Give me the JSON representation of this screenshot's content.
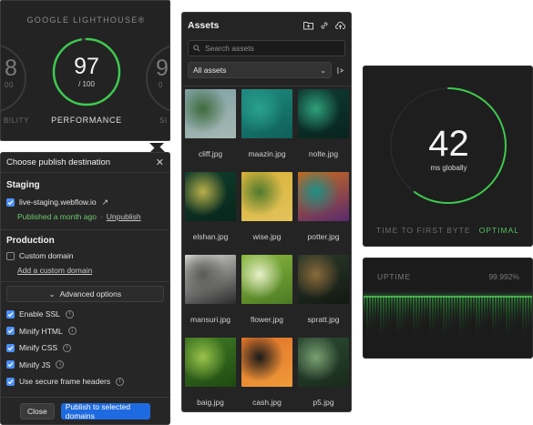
{
  "lighthouse": {
    "title": "GOOGLE LIGHTHOUSE®",
    "main_score": "97",
    "main_sub": "/ 100",
    "main_label": "PERFORMANCE",
    "main_progress": 0.97,
    "left_ghost_score": "8",
    "left_ghost_sub": "00",
    "left_ghost_label": "BILITY",
    "right_ghost_score": "9",
    "right_ghost_sub": "0",
    "right_ghost_label": "SI",
    "accent": "#3ec94e"
  },
  "publish": {
    "title": "Choose publish destination",
    "staging": {
      "heading": "Staging",
      "domain": "live-staging.webflow.io",
      "status": "Published a month ago",
      "separator": "·",
      "unpublish": "Unpublish",
      "checked": true
    },
    "production": {
      "heading": "Production",
      "custom_domain": "Custom domain",
      "add_link": "Add a custom domain",
      "checked": false
    },
    "advanced_label": "Advanced options",
    "options": [
      {
        "label": "Enable SSL",
        "checked": true
      },
      {
        "label": "Minify HTML",
        "checked": true
      },
      {
        "label": "Minify CSS",
        "checked": true
      },
      {
        "label": "Minify JS",
        "checked": true
      },
      {
        "label": "Use secure frame headers",
        "checked": true
      }
    ],
    "close_label": "Close",
    "publish_label": "Publish to selected domains"
  },
  "assets": {
    "title": "Assets",
    "search_placeholder": "Search assets",
    "filter_value": "All assets",
    "items": [
      {
        "name": "cliff.jpg",
        "colors": [
          "#7ea0a4",
          "#3e6a3c",
          "#a7b9b4"
        ]
      },
      {
        "name": "maazin.jpg",
        "colors": [
          "#1d8a7e",
          "#2aa08f",
          "#0f5f59"
        ]
      },
      {
        "name": "nolte.jpg",
        "colors": [
          "#0f3b33",
          "#2ea17a",
          "#08231f"
        ]
      },
      {
        "name": "elshan.jpg",
        "colors": [
          "#0f3d2c",
          "#b8b04a",
          "#07261b"
        ]
      },
      {
        "name": "wise.jpg",
        "colors": [
          "#d9b23a",
          "#4f7a2e",
          "#e2c35a"
        ]
      },
      {
        "name": "potter.jpg",
        "colors": [
          "#c96b1c",
          "#1e8f86",
          "#5a2a6e"
        ]
      },
      {
        "name": "mansuri.jpg",
        "colors": [
          "#d6d6d4",
          "#5a5a58",
          "#2b2b2b"
        ]
      },
      {
        "name": "flower.jpg",
        "colors": [
          "#8ab83e",
          "#e8f0c8",
          "#4b7a24"
        ]
      },
      {
        "name": "spratt.jpg",
        "colors": [
          "#2c3a2a",
          "#8a6a3a",
          "#121812"
        ]
      },
      {
        "name": "baig.jpg",
        "colors": [
          "#3f7a22",
          "#9ac24a",
          "#1f4a12"
        ]
      },
      {
        "name": "cash.jpg",
        "colors": [
          "#e0742a",
          "#1a1a1a",
          "#f09a3a"
        ]
      },
      {
        "name": "p5.jpg",
        "colors": [
          "#2a4a32",
          "#7aa072",
          "#1a2a1c"
        ]
      }
    ]
  },
  "ttfb": {
    "value": "42",
    "unit": "ms globally",
    "label": "TIME TO FIRST BYTE",
    "status": "OPTIMAL",
    "progress": 0.6,
    "accent": "#3ec94e"
  },
  "uptime": {
    "label": "UPTIME",
    "value": "99.992%",
    "accent": "#3ec94e"
  }
}
